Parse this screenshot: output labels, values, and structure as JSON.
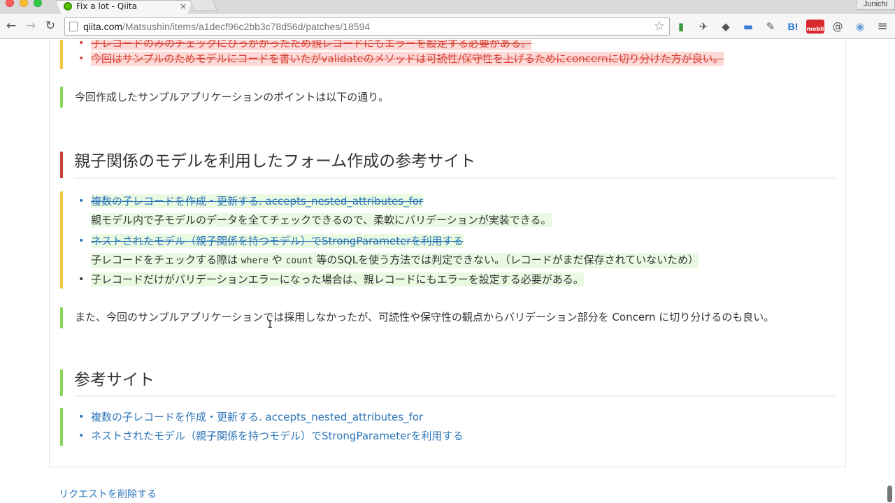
{
  "browser": {
    "tab_title": "Fix a lot - Qiita",
    "tab_close": "×",
    "profile_name": "Junichi",
    "url_host": "qiita.com",
    "url_path": "/Matsushin/items/a1decf96c2bb3c78d56d/patches/18594",
    "back_glyph": "←",
    "forward_glyph": "→",
    "reload_glyph": "↻",
    "bookmark_glyph": "☆"
  },
  "extensions": [
    {
      "icon": "evernote-icon",
      "glyph": "▮"
    },
    {
      "icon": "bird-icon",
      "glyph": "✈"
    },
    {
      "icon": "elephant-icon",
      "glyph": "◆"
    },
    {
      "icon": "chat-bubble-icon",
      "glyph": "▬"
    },
    {
      "icon": "eyedropper-icon",
      "glyph": "✎"
    },
    {
      "icon": "hatena-bookmark-icon",
      "glyph": "B!"
    },
    {
      "icon": "mobli-icon",
      "glyph": "mobli"
    },
    {
      "icon": "page-at-icon",
      "glyph": "@"
    },
    {
      "icon": "camera-icon",
      "glyph": "◉"
    },
    {
      "icon": "menu-icon",
      "glyph": "≡"
    }
  ],
  "content": {
    "top_deleted_1": "子レコードのみのチェックにひっかかったため親レコードにもエラーを設定する必要がある。",
    "top_deleted_2": "今回はサンプルのためモデルにコードを書いたがvalidateのメソッドは可読性/保守性を上げるためにconcernに切り分けた方が良い。",
    "sample_points": "今回作成したサンプルアプリケーションのポイントは以下の通り。",
    "heading_1": "親子関係のモデルを利用したフォーム作成の参考サイト",
    "list1_item1_link": "複数の子レコードを作成・更新する. accepts_nested_attributes_for",
    "list1_item1_desc": "親モデル内で子モデルのデータを全てチェックできるので、柔軟にバリデーションが実装できる。",
    "list1_item2_link": "ネストされたモデル（親子関係を持つモデル）でStrongParameterを利用する",
    "list1_item2_desc_a": "子レコードをチェックする際は ",
    "list1_item2_code1": "where",
    "list1_item2_desc_b": " や ",
    "list1_item2_code2": "count",
    "list1_item2_desc_c": " 等のSQLを使う方法では判定できない。（レコードがまだ保存されていないため）",
    "list1_item3": "子レコードだけがバリデーションエラーになった場合は、親レコードにもエラーを設定する必要がある。",
    "also_note": "また、今回のサンプルアプリケーションでは採用しなかったが、可読性や保守性の観点からバリデーション部分を Concern に切り分けるのも良い。",
    "heading_2": "参考サイト",
    "ref_link_1": "複数の子レコードを作成・更新する. accepts_nested_attributes_for",
    "ref_link_2": "ネストされたモデル（親子関係を持つモデル）でStrongParameterを利用する",
    "delete_request": "リクエストを削除する",
    "bullet": "•"
  },
  "colors": {
    "deleted_text": "#d64135",
    "deleted_bg": "#fdd9d7",
    "inserted_bg": "#eafae2",
    "link": "#2b74b8",
    "bar_yellow": "#f3c744",
    "bar_green": "#88d65b",
    "bar_red": "#c6443a"
  }
}
